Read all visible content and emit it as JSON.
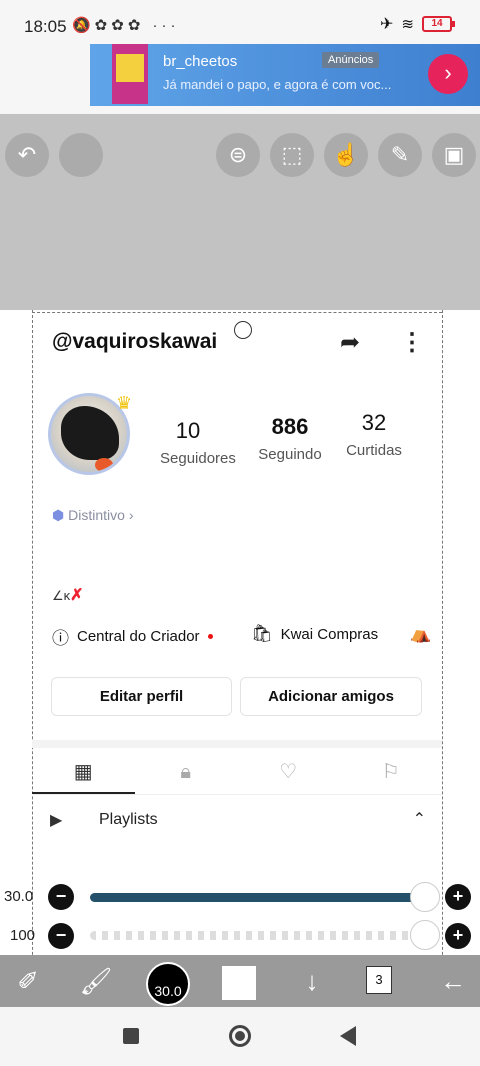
{
  "status_bar": {
    "time": "18:05",
    "battery": "14"
  },
  "ad": {
    "name": "br_cheetos",
    "message": "Já mandei o papo, e agora é com voc...",
    "tag": "Anúncios"
  },
  "profile": {
    "username": "@vaquiroskawai",
    "stats": [
      {
        "value": "10",
        "label": "Seguidores"
      },
      {
        "value": "886",
        "label": "Seguindo"
      },
      {
        "value": "32",
        "label": "Curtidas"
      }
    ],
    "badge": "Distintivo",
    "bio": "∠κ",
    "quick_links": [
      "Central do Criador",
      "Kwai Compras"
    ],
    "buttons": {
      "edit": "Editar perfil",
      "add": "Adicionar amigos"
    },
    "playlists_label": "Playlists"
  },
  "sliders": {
    "size_label": "30.0",
    "opacity_label": "100",
    "size_fraction": 1.0,
    "opacity_fraction": 1.0
  },
  "tools": {
    "brush_size": "30.0",
    "layer_count": "3"
  }
}
